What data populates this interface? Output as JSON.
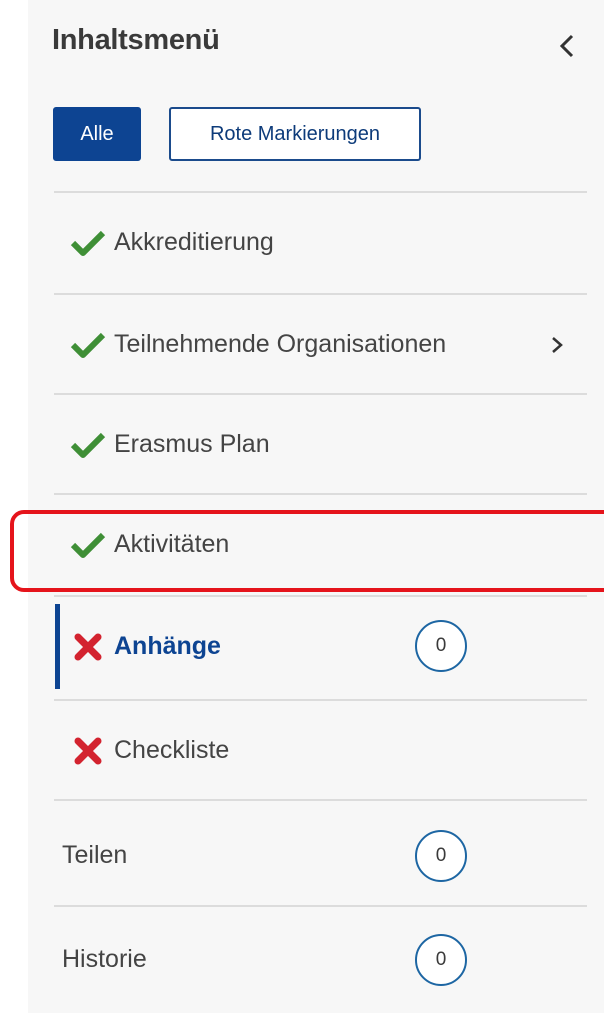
{
  "header": {
    "title": "Inhaltsmenü"
  },
  "filters": {
    "all_label": "Alle",
    "red_label": "Rote Markierungen"
  },
  "items": [
    {
      "label": "Akkreditierung",
      "status": "check-icon"
    },
    {
      "label": "Teilnehmende Organisationen",
      "status": "check-icon",
      "has_submenu": true
    },
    {
      "label": "Erasmus Plan",
      "status": "check-icon"
    },
    {
      "label": "Aktivitäten",
      "status": "check-icon",
      "highlighted": true
    },
    {
      "label": "Anhänge",
      "status": "cross-icon",
      "active": true,
      "count": "0"
    },
    {
      "label": "Checkliste",
      "status": "cross-icon"
    },
    {
      "label": "Teilen",
      "count": "0"
    },
    {
      "label": "Historie",
      "count": "0"
    }
  ],
  "colors": {
    "brand_blue": "#0d4492",
    "check_green": "#3f8f36",
    "cross_red": "#d3232f",
    "highlight_red": "#e5141b"
  }
}
